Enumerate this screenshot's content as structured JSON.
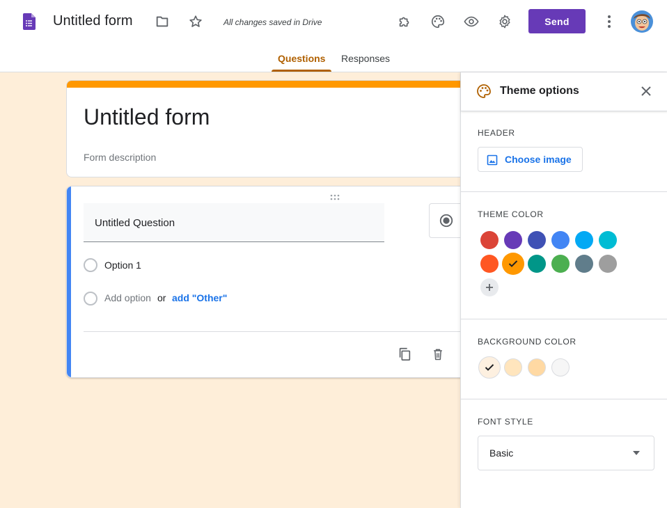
{
  "header": {
    "title": "Untitled form",
    "saved_status": "All changes saved in Drive",
    "send_label": "Send",
    "icons": [
      "forms-logo-icon",
      "folder-icon",
      "star-icon",
      "addon-puzzle-icon",
      "palette-icon",
      "preview-eye-icon",
      "settings-gear-icon",
      "more-vert-icon"
    ]
  },
  "tabs": [
    {
      "label": "Questions",
      "active": true
    },
    {
      "label": "Responses",
      "active": false
    }
  ],
  "form": {
    "title": "Untitled form",
    "description_placeholder": "Form description",
    "question": {
      "title": "Untitled Question",
      "options": [
        "Option 1"
      ],
      "add_option": "Add option",
      "or": "or",
      "add_other": "add \"Other\""
    }
  },
  "theme_panel": {
    "title": "Theme options",
    "header_label": "HEADER",
    "choose_image_label": "Choose image",
    "theme_color_label": "THEME COLOR",
    "theme_colors": [
      "#db4437",
      "#673ab7",
      "#3f51b5",
      "#4285f4",
      "#03a9f4",
      "#00bcd4",
      "#ff5722",
      "#ff9800",
      "#009688",
      "#4caf50",
      "#607d8b",
      "#9e9e9e"
    ],
    "selected_theme_color": "#ff9800",
    "background_color_label": "BACKGROUND COLOR",
    "background_colors": [
      "#fdf0e0",
      "#ffe5bd",
      "#ffd9a3",
      "#f6f6f6"
    ],
    "selected_background_color": "#fdf0e0",
    "font_style_label": "FONT STYLE",
    "font_style_value": "Basic"
  },
  "colors": {
    "accent": "#673ab7",
    "tab_active": "#b06000",
    "canvas_bg": "#feeed9",
    "title_strip": "#ff9800",
    "question_bar": "#4285f4"
  }
}
